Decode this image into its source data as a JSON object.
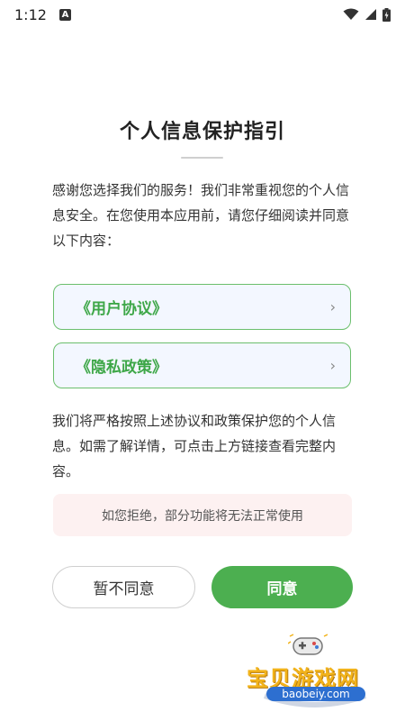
{
  "status_bar": {
    "time": "1:12",
    "notification_badge": "A",
    "icons": [
      "wifi-icon",
      "signal-icon",
      "battery-icon"
    ]
  },
  "dialog": {
    "title": "个人信息保护指引",
    "intro": " 感谢您选择我们的服务！我们非常重视您的个人信息安全。在您使用本应用前，请您仔细阅读并同意以下内容：",
    "links": [
      {
        "label": "《用户协议》",
        "chevron": "›"
      },
      {
        "label": "《隐私政策》",
        "chevron": "›"
      }
    ],
    "body": " 我们将严格按照上述协议和政策保护您的个人信息。如需了解详情，可点击上方链接查看完整内容。",
    "warning": "如您拒绝，部分功能将无法正常使用",
    "decline_label": "暂不同意",
    "agree_label": "同意"
  },
  "watermark": {
    "brand": "宝贝游戏网",
    "url": "baobeiy.com"
  },
  "colors": {
    "accent": "#4caf50",
    "link_text": "#3ea748",
    "link_border": "#6bbf6d",
    "warning_bg": "#fdf1f1"
  }
}
